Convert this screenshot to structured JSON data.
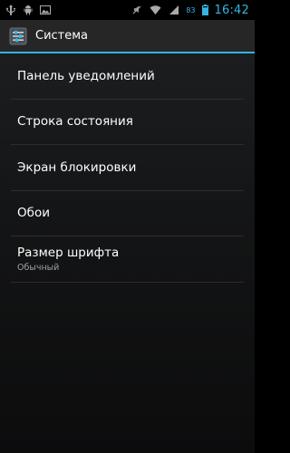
{
  "status_bar": {
    "icons_left": [
      "usb-icon",
      "android-debug-icon",
      "image-icon"
    ],
    "icons_right": [
      "mute-icon",
      "wifi-icon",
      "signal-icon",
      "battery-icon"
    ],
    "battery_level": "83",
    "time": "16:42",
    "accent_color": "#33b5e5"
  },
  "action_bar": {
    "icon": "settings-app-icon",
    "title": "Система"
  },
  "settings": {
    "items": [
      {
        "label": "Панель уведомлений"
      },
      {
        "label": "Строка состояния"
      },
      {
        "label": "Экран блокировки"
      },
      {
        "label": "Обои"
      },
      {
        "label": "Размер шрифта",
        "summary": "Обычный"
      }
    ]
  }
}
